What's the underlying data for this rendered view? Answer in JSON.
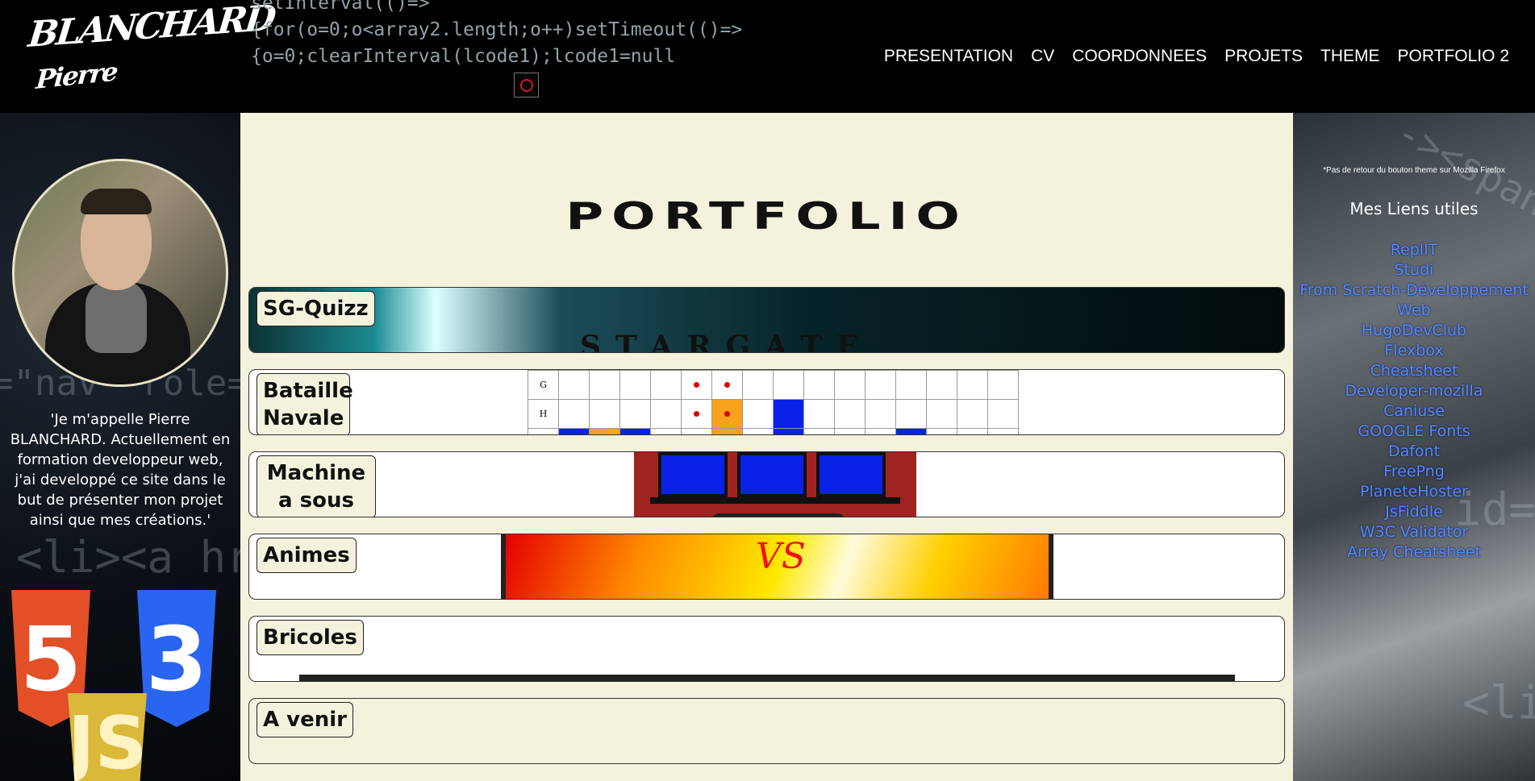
{
  "header": {
    "logo_main": "BLANCHARD",
    "logo_sub": "Pierre",
    "code_lines": [
      "setInterval(()=>",
      "{for(o=0;o<array2.length;o++)setTimeout(()=>",
      "{o=0;clearInterval(lcode1);lcode1=null"
    ],
    "nav": [
      "PRESENTATION",
      "CV",
      "COORDONNEES",
      "PROJETS",
      "THEME",
      "PORTFOLIO 2"
    ]
  },
  "left": {
    "bio": "'Je m'appelle Pierre BLANCHARD. Actuellement en formation developpeur web, j'ai developpé ce site dans le but de présenter mon projet ainsi que mes créations.'",
    "badges": {
      "html": "5",
      "css": "3",
      "js": "JS"
    }
  },
  "main": {
    "title": "PORTFOLIO",
    "projects": [
      {
        "label": "SG-Quizz"
      },
      {
        "label": "Bataille Navale",
        "grid_rows": [
          "G",
          "H"
        ]
      },
      {
        "label": "Machine a sous"
      },
      {
        "label": "Animes",
        "vs": "VS"
      },
      {
        "label": "Bricoles"
      },
      {
        "label": "A venir"
      }
    ]
  },
  "right": {
    "note": "*Pas de retour du bouton theme sur Mozilla Firefox",
    "title": "Mes Liens utiles",
    "links": [
      "ReplIT",
      "Studi",
      "From Scratch-Développement Web",
      "HugoDevClub",
      "Flexbox",
      "Cheatsheet",
      "Developer-mozilla",
      "Caniuse",
      "GOOGLE Fonts",
      "Dafont",
      "FreePng",
      "PlaneteHoster",
      "JsFiddle",
      "W3C Validator",
      "Array Cheatsheet"
    ]
  },
  "colors": {
    "bg_main": "#f4f2dd",
    "link": "#4e8bff",
    "ship_blue": "#0a22e8",
    "ship_orange": "#f7a21b"
  }
}
